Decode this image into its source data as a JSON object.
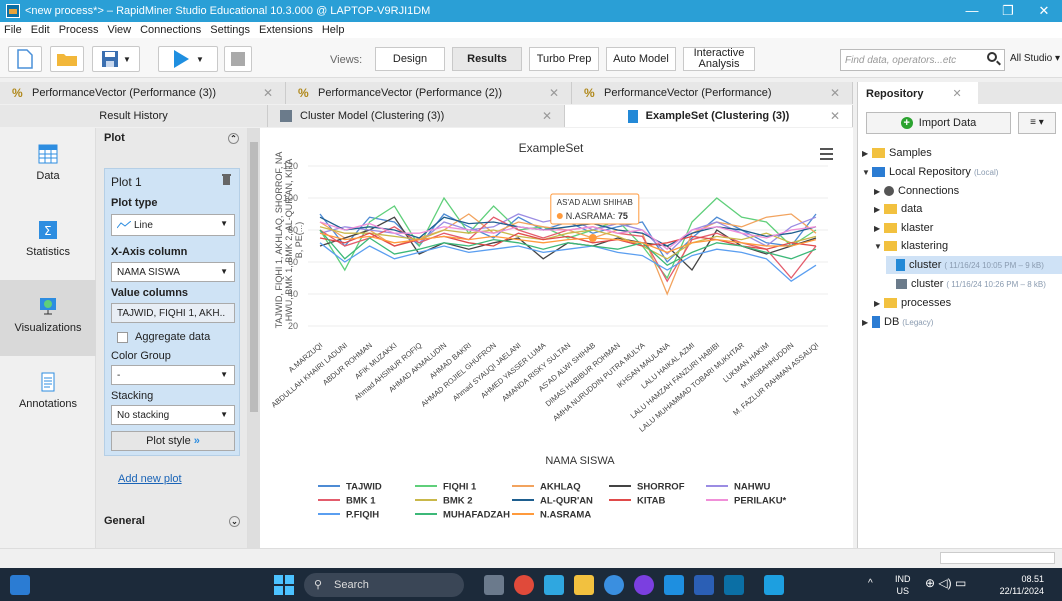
{
  "window": {
    "title": "<new process*> – RapidMiner Studio Educational 10.3.000 @ LAPTOP-V9RJI1DM",
    "controls": [
      "—",
      "❐",
      "✕"
    ]
  },
  "menu": [
    "File",
    "Edit",
    "Process",
    "View",
    "Connections",
    "Settings",
    "Extensions",
    "Help"
  ],
  "toolbar": {
    "views_label": "Views:",
    "views": [
      "Design",
      "Results",
      "Turbo Prep",
      "Auto Model",
      "Interactive Analysis"
    ],
    "active_view": "Results",
    "search_placeholder": "Find data, operators...etc",
    "search_scope": "All Studio ▾"
  },
  "tabs_row1": [
    {
      "label": "PerformanceVector (Performance (3))"
    },
    {
      "label": "PerformanceVector (Performance (2))"
    },
    {
      "label": "PerformanceVector (Performance)"
    }
  ],
  "tabs_row2": [
    {
      "label": "Result History"
    },
    {
      "label": "Cluster Model (Clustering (3))"
    },
    {
      "label": "ExampleSet (Clustering (3))"
    }
  ],
  "leftnav": [
    "Data",
    "Statistics",
    "Visualizations",
    "Annotations"
  ],
  "plot_panel": {
    "header": "Plot",
    "plot_name": "Plot 1",
    "plot_type_label": "Plot type",
    "plot_type": "Line",
    "x_axis_label": "X-Axis column",
    "x_axis": "NAMA SISWA",
    "value_columns_label": "Value columns",
    "value_columns": "TAJWID, FIQHI 1, AKH..",
    "aggregate_label": "Aggregate data",
    "color_group_label": "Color Group",
    "color_group": "-",
    "stacking_label": "Stacking",
    "stacking": "No stacking",
    "plot_style": "Plot style",
    "add_plot": "Add new plot",
    "general": "General"
  },
  "repository": {
    "tab": "Repository",
    "import": "Import Data",
    "menu": "≡ ▾",
    "tree": [
      {
        "label": "Samples",
        "meta": ""
      },
      {
        "label": "Local Repository",
        "meta": "(Local)"
      },
      {
        "label": "Connections",
        "meta": ""
      },
      {
        "label": "data",
        "meta": ""
      },
      {
        "label": "klaster",
        "meta": ""
      },
      {
        "label": "klastering",
        "meta": ""
      },
      {
        "label": "cluster",
        "meta": "( 11/16/24 10:05 PM – 9 kB)"
      },
      {
        "label": "cluster",
        "meta": "( 11/16/24 10:26 PM – 8 kB)"
      },
      {
        "label": "processes",
        "meta": ""
      },
      {
        "label": "DB",
        "meta": "(Legacy)"
      }
    ]
  },
  "taskbar": {
    "search": "Search",
    "lang": "IND",
    "region": "US",
    "time": "08.51",
    "date": "22/11/2024"
  },
  "chart_data": {
    "type": "line",
    "title": "ExampleSet",
    "xlabel": "NAMA SISWA",
    "ylabel": "TAJWID, FIQHI 1, AKHLAQ, SHORROF, NAHWU, BMK 1, BMK 2, AL-QUR'AN, KITAB, PE(...)",
    "ylim": [
      20,
      120
    ],
    "yticks": [
      20,
      40,
      60,
      80,
      100,
      120
    ],
    "categories": [
      "A.MARZUQI",
      "ABDULLAH KHAIRI LADUNI",
      "ABDUR ROHMAN",
      "AFIK MUZAKKI",
      "Ahmad AHSINUR ROFIQ",
      "AHMAD AKMALUDIN",
      "AHMAD BAKRI",
      "AHMAD ROJIEL GHUFRON",
      "Ahmad SYAUQI JAELANI",
      "AHMED YASSER LUMA",
      "AMANDA RISKY SULTAN",
      "AS'AD ALWI SHIHAB",
      "DIMAS HABIBUR ROHMAN",
      "AMHA NURUDDIN PUTRA MULYA",
      "IKHSAN MAULANA",
      "LALU HAIKAL AZMI",
      "LALU HAMZAH FANZURI HABIBI",
      "LALU MUHAMMAD TOBARI MUKHTAR",
      "LUKMAN HAKIM",
      "M.MISBAHHUDDIN",
      "M. FAZLUR RAHMAN ASSAUQI"
    ],
    "series": [
      {
        "name": "TAJWID",
        "color": "#4e8bd4",
        "values": [
          90,
          70,
          88,
          85,
          70,
          90,
          82,
          75,
          88,
          80,
          85,
          78,
          82,
          85,
          60,
          75,
          88,
          80,
          72,
          70,
          90
        ]
      },
      {
        "name": "FIQHI 1",
        "color": "#5fcf7a",
        "values": [
          80,
          55,
          85,
          95,
          70,
          100,
          78,
          95,
          80,
          82,
          75,
          80,
          86,
          70,
          50,
          85,
          100,
          88,
          85,
          70,
          80
        ]
      },
      {
        "name": "AKHLAQ",
        "color": "#f2a35e",
        "values": [
          85,
          75,
          80,
          70,
          75,
          80,
          90,
          78,
          85,
          82,
          80,
          75,
          80,
          78,
          40,
          78,
          85,
          82,
          88,
          90,
          78
        ]
      },
      {
        "name": "SHORROF",
        "color": "#444444",
        "values": [
          70,
          75,
          80,
          88,
          65,
          72,
          68,
          72,
          75,
          62,
          72,
          70,
          75,
          72,
          70,
          55,
          80,
          70,
          65,
          70,
          75
        ]
      },
      {
        "name": "NAHWU",
        "color": "#9b8ce3",
        "values": [
          78,
          82,
          80,
          78,
          72,
          85,
          80,
          82,
          90,
          85,
          88,
          80,
          84,
          80,
          65,
          80,
          85,
          78,
          70,
          82,
          88
        ]
      },
      {
        "name": "BMK 1",
        "color": "#e35c6c",
        "values": [
          80,
          70,
          75,
          82,
          72,
          78,
          74,
          88,
          80,
          75,
          80,
          82,
          78,
          76,
          48,
          74,
          78,
          72,
          68,
          50,
          70
        ]
      },
      {
        "name": "BMK 2",
        "color": "#c9b84a",
        "values": [
          82,
          78,
          78,
          76,
          74,
          80,
          78,
          80,
          76,
          74,
          78,
          80,
          76,
          70,
          62,
          72,
          76,
          74,
          78,
          72,
          76
        ]
      },
      {
        "name": "AL-QUR'AN",
        "color": "#1e5e8f",
        "values": [
          88,
          80,
          82,
          80,
          75,
          88,
          84,
          85,
          82,
          80,
          82,
          84,
          80,
          78,
          70,
          78,
          82,
          80,
          76,
          78,
          82
        ]
      },
      {
        "name": "KITAB",
        "color": "#e04a4a",
        "values": [
          75,
          72,
          78,
          70,
          74,
          76,
          72,
          70,
          78,
          74,
          76,
          72,
          74,
          70,
          72,
          76,
          74,
          70,
          68,
          72,
          70
        ]
      },
      {
        "name": "PERILAKU*",
        "color": "#f08fd8",
        "values": [
          85,
          80,
          84,
          78,
          78,
          82,
          80,
          78,
          82,
          80,
          80,
          82,
          78,
          80,
          68,
          80,
          82,
          78,
          75,
          80,
          82
        ]
      },
      {
        "name": "P.FIQIH",
        "color": "#5a9ef0",
        "values": [
          72,
          60,
          70,
          62,
          66,
          70,
          66,
          68,
          70,
          66,
          68,
          70,
          66,
          64,
          55,
          64,
          68,
          66,
          62,
          48,
          58
        ]
      },
      {
        "name": "MUHAFADZAH",
        "color": "#3cb878",
        "values": [
          80,
          62,
          75,
          65,
          68,
          72,
          70,
          74,
          72,
          68,
          72,
          70,
          68,
          72,
          58,
          66,
          72,
          70,
          66,
          62,
          68
        ]
      },
      {
        "name": "N.ASRAMA",
        "color": "#ff9a3c",
        "values": [
          78,
          74,
          76,
          72,
          74,
          76,
          74,
          76,
          74,
          72,
          74,
          75,
          74,
          72,
          66,
          72,
          74,
          72,
          70,
          70,
          74
        ]
      }
    ],
    "tooltip": {
      "category": "AS'AD ALWI SHIHAB",
      "series": "N.ASRAMA",
      "value": "75"
    }
  }
}
